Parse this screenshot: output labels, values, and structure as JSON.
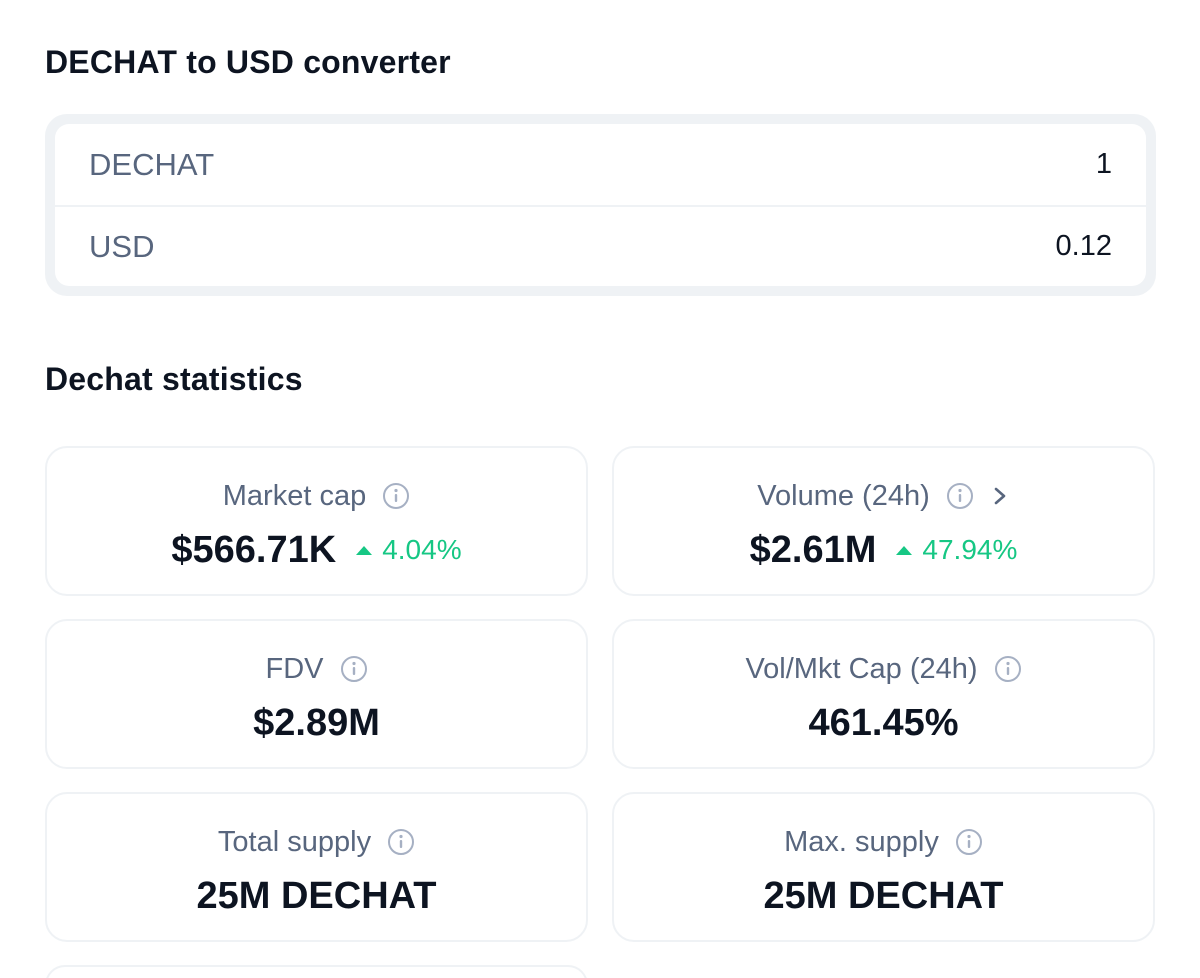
{
  "converter": {
    "title": "DECHAT to USD converter",
    "rows": [
      {
        "symbol": "DECHAT",
        "value": "1"
      },
      {
        "symbol": "USD",
        "value": "0.12"
      }
    ]
  },
  "statistics": {
    "title": "Dechat statistics",
    "cards": [
      {
        "label": "Market cap",
        "value": "$566.71K",
        "change": "4.04%",
        "change_direction": "up"
      },
      {
        "label": "Volume (24h)",
        "value": "$2.61M",
        "change": "47.94%",
        "change_direction": "up"
      },
      {
        "label": "FDV",
        "value": "$2.89M"
      },
      {
        "label": "Vol/Mkt Cap (24h)",
        "value": "461.45%"
      },
      {
        "label": "Total supply",
        "value": "25M DECHAT"
      },
      {
        "label": "Max. supply",
        "value": "25M DECHAT"
      }
    ]
  },
  "colors": {
    "text_primary": "#0d1421",
    "text_secondary": "#58667e",
    "positive": "#16c784",
    "border": "#eff2f5"
  },
  "icons": {
    "info": "info-circle-icon",
    "chevron": "chevron-right-icon",
    "up": "caret-up-icon"
  }
}
